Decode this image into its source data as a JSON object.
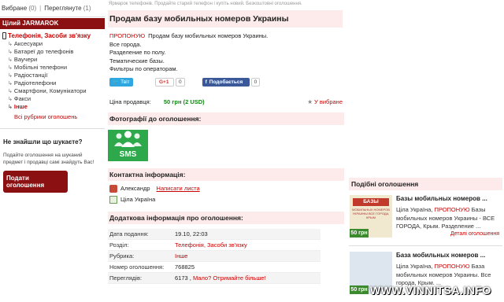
{
  "topbar": {
    "favorites": "Вибране",
    "favorites_count": "(0)",
    "viewed": "Переглянуте",
    "viewed_count": "(1)"
  },
  "notice": "Ярмарок телефонів. Продайте старий телефон і купіть новий. Безкоштовні оголошення.",
  "sidebar": {
    "heading": "Цілий JARMAROK",
    "category": "Телефонія, Засоби зв'язку",
    "subcategories": [
      {
        "label": "Аксесуари"
      },
      {
        "label": "Батареї до телефонів"
      },
      {
        "label": "Ваучери"
      },
      {
        "label": "Мобільні телефони"
      },
      {
        "label": "Радіостанції"
      },
      {
        "label": "Радіотелефони"
      },
      {
        "label": "Смартфони, Комунікатори"
      },
      {
        "label": "Факси"
      },
      {
        "label": "Інше"
      }
    ],
    "all_rubrics": "Всі рубрики оголошень",
    "not_found_title": "Не знайшли що шукаєте?",
    "not_found_text": "Подайте оголошення на шуканий предмет і продавці самі знайдуть Вас!",
    "post_button": "Подати оголошення"
  },
  "ad": {
    "title": "Продам базу мобильных номеров Украины",
    "tag": "ПРОПОНУЮ",
    "desc_first": "Продам базу мобильных номеров Украины.",
    "desc_lines": [
      "Все города.",
      "Разделение по полу.",
      "Тематические базы.",
      "Фильтры по операторам."
    ],
    "social": {
      "tweet": "Твіт",
      "gplus": "G+1",
      "gplus_count": "0",
      "fb": "Подобається",
      "fb_count": "0"
    },
    "price_label": "Ціна продавця:",
    "price_value": "50 грн (2 USD)",
    "favorite": "У вибране"
  },
  "photos": {
    "title": "Фотографії до оголошення:",
    "thumb_text": "SMS"
  },
  "contact": {
    "title": "Контактна інформація:",
    "name": "Александр",
    "write_link": "Написати листа",
    "location": "Ціла Україна"
  },
  "extra": {
    "title": "Додаткова інформація про оголошення:",
    "rows": [
      {
        "key": "Дата подання:",
        "value": "19.10, 22:03"
      },
      {
        "key": "Розділ:",
        "value": "Телефонія, Засоби зв'язку"
      },
      {
        "key": "Рубрика:",
        "value": "Інше"
      },
      {
        "key": "Номер оголошення:",
        "value": "768825"
      },
      {
        "key": "Переглядів:",
        "value": "6173 ,",
        "link": "Мало? Отримайте більше!"
      }
    ]
  },
  "similar": {
    "title": "Подібні оголошення",
    "items": [
      {
        "name": "Базы мобильных номеров ...",
        "tag": "ПРОПОНУЮ",
        "desc_before": "Ціла Україна,",
        "desc_after": "Базы мобильных номеров Украины - ВСЕ ГОРОДА, Крым. Разделение ...",
        "price": "50 грн",
        "img_band": "БАЗЫ",
        "img_small": "МОБИЛЬНЫХ НОМЕРОВ УКРАИНЫ ВСЕ ГОРОДА, КРЫМ",
        "details": "Деталі оголошення"
      },
      {
        "name": "База мобильных номеров ...",
        "tag": "ПРОПОНУЮ",
        "desc_before": "Ціла Україна,",
        "desc_after": "База мобильных номеров Украины. Все города, Крым. ...",
        "price": "50 грн",
        "img_band": "",
        "img_small": "",
        "details": ""
      }
    ]
  },
  "watermark": "WWW.VINNITSA.INFO"
}
